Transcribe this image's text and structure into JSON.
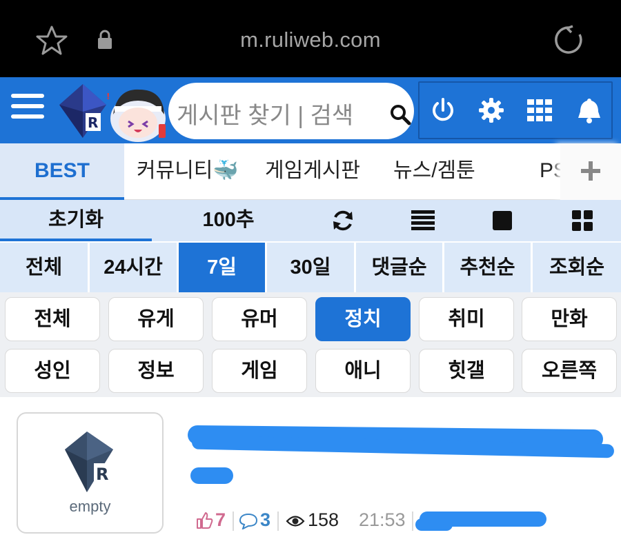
{
  "browser": {
    "url": "m.ruliweb.com",
    "icons": [
      "star-icon",
      "lock-icon",
      "reload-icon"
    ]
  },
  "header": {
    "search_placeholder": "게시판 찾기 | 검색",
    "icons": [
      "menu-icon",
      "power-icon",
      "gear-icon",
      "grid-icon",
      "bell-icon"
    ],
    "colors": {
      "primary": "#1e73d6",
      "accent_yellow": "#ffe100"
    }
  },
  "tabs": [
    {
      "label": "BEST",
      "active": true
    },
    {
      "label": "커뮤니티🐳",
      "active": false
    },
    {
      "label": "게임게시판",
      "active": false
    },
    {
      "label": "뉴스/겜툰",
      "active": false
    },
    {
      "label": "PS",
      "active": false
    }
  ],
  "toolbar": {
    "reset_label": "초기화",
    "recommend_label": "100추",
    "icons": [
      "refresh-icon",
      "list-view-icon",
      "single-view-icon",
      "grid-view-icon"
    ]
  },
  "periods": [
    {
      "label": "전체",
      "active": false
    },
    {
      "label": "24시간",
      "active": false
    },
    {
      "label": "7일",
      "active": true
    },
    {
      "label": "30일",
      "active": false
    },
    {
      "label": "댓글순",
      "active": false
    },
    {
      "label": "추천순",
      "active": false
    },
    {
      "label": "조회순",
      "active": false
    }
  ],
  "categories": [
    {
      "label": "전체",
      "active": false
    },
    {
      "label": "유게",
      "active": false
    },
    {
      "label": "유머",
      "active": false
    },
    {
      "label": "정치",
      "active": true
    },
    {
      "label": "취미",
      "active": false
    },
    {
      "label": "만화",
      "active": false
    },
    {
      "label": "성인",
      "active": false
    },
    {
      "label": "정보",
      "active": false
    },
    {
      "label": "게임",
      "active": false
    },
    {
      "label": "애니",
      "active": false
    },
    {
      "label": "힛갤",
      "active": false
    },
    {
      "label": "오른쪽",
      "active": false
    }
  ],
  "post": {
    "thumbnail_text": "empty",
    "likes": "7",
    "comments": "3",
    "views": "158",
    "time": "21:53"
  }
}
